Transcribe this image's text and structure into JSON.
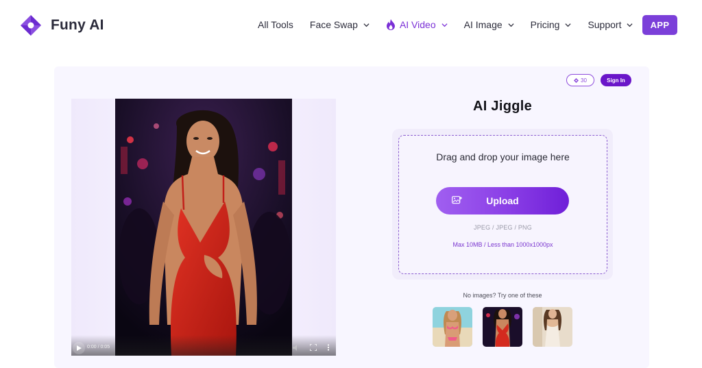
{
  "brand": {
    "name": "Funy AI",
    "logo_icon": "funy-logo-icon",
    "accent": "#7b3fd9"
  },
  "nav": {
    "items": [
      {
        "label": "All Tools",
        "dropdown": false
      },
      {
        "label": "Face Swap",
        "dropdown": true
      },
      {
        "label": "AI Video",
        "dropdown": true,
        "active": true,
        "icon": "flame-icon"
      },
      {
        "label": "AI Image",
        "dropdown": true
      },
      {
        "label": "Pricing",
        "dropdown": true
      },
      {
        "label": "Support",
        "dropdown": true
      }
    ],
    "app_button": "APP"
  },
  "account": {
    "credits": "30",
    "credits_icon": "diamond-icon",
    "signin_label": "Sign In"
  },
  "video": {
    "time": "0:00 / 0:05"
  },
  "tool": {
    "title": "AI Jiggle",
    "drop_text": "Drag and drop your image here",
    "upload_label": "Upload",
    "formats": "JPEG / JPEG / PNG",
    "limits": "Max 10MB / Less than 1000x1000px",
    "no_images": "No images? Try one of these"
  },
  "samples": [
    {
      "name": "sample-image-pink-bikini"
    },
    {
      "name": "sample-image-red-dress"
    },
    {
      "name": "sample-image-white-dress"
    }
  ]
}
